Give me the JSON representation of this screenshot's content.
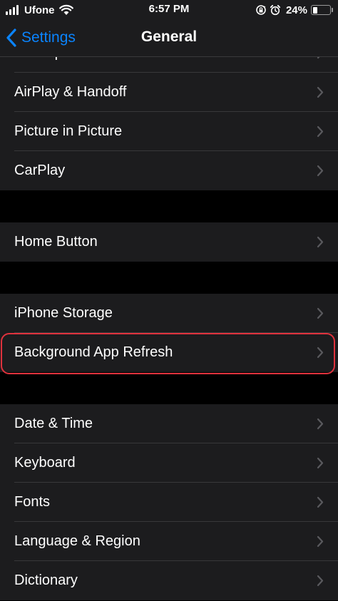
{
  "status_bar": {
    "carrier": "Ufone",
    "time": "6:57 PM",
    "battery_percent": "24%",
    "battery_level": 0.24
  },
  "nav": {
    "back_label": "Settings",
    "title": "General"
  },
  "groups": [
    {
      "items": [
        {
          "label": "AirDrop",
          "partial": true
        },
        {
          "label": "AirPlay & Handoff"
        },
        {
          "label": "Picture in Picture"
        },
        {
          "label": "CarPlay"
        }
      ]
    },
    {
      "items": [
        {
          "label": "Home Button"
        }
      ]
    },
    {
      "items": [
        {
          "label": "iPhone Storage"
        },
        {
          "label": "Background App Refresh",
          "highlighted": true
        }
      ]
    },
    {
      "items": [
        {
          "label": "Date & Time"
        },
        {
          "label": "Keyboard"
        },
        {
          "label": "Fonts"
        },
        {
          "label": "Language & Region"
        },
        {
          "label": "Dictionary"
        }
      ]
    }
  ],
  "colors": {
    "accent": "#0a84ff",
    "highlight_border": "#e0323d",
    "row_background": "#1c1c1e",
    "page_background": "#000000"
  }
}
